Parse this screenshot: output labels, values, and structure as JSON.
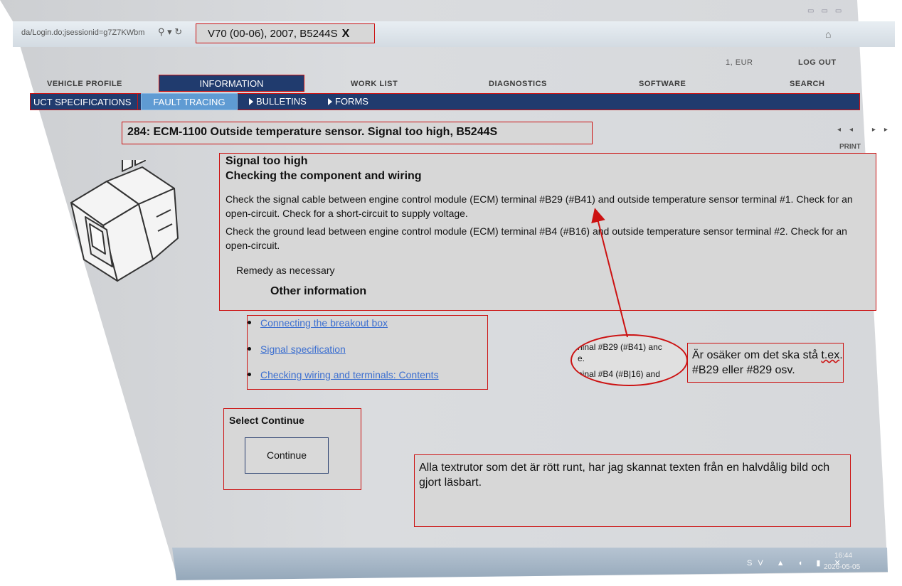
{
  "browser": {
    "url": "da/Login.do;jsessionid=g7Z7KWbm",
    "url_icons": "⚲ ▾ ↻",
    "right_icons": "⌂",
    "window_controls": "▭▭▭"
  },
  "tab": {
    "title": "V70 (00-06), 2007, B5244S",
    "close_label": "X"
  },
  "header": {
    "currency": "1, EUR",
    "logout": "LOG OUT"
  },
  "top_nav": {
    "vehicle_profile": "VEHICLE PROFILE",
    "information": "INFORMATION",
    "work_list": "WORK LIST",
    "diagnostics": "DIAGNOSTICS",
    "software": "SOFTWARE",
    "search": "SEARCH"
  },
  "sub_nav": {
    "product_specifications": "UCT SPECIFICATIONS",
    "fault_tracing": "FAULT TRACING",
    "bulletins": "BULLETINS",
    "forms": "FORMS"
  },
  "page": {
    "title": "284: ECM-1100 Outside temperature sensor. Signal too high, B5244S",
    "pager": "◂◂ ▸▸",
    "print": "PRINT"
  },
  "content": {
    "heading1": "Signal too high",
    "heading2": "Checking the component and wiring",
    "para1": "Check the signal cable between engine control module (ECM) terminal #B29 (#B41) and outside temperature sensor terminal #1. Check for an open-circuit. Check for a short-circuit to supply voltage.",
    "para2": "Check the ground lead between engine control module (ECM) terminal #B4 (#B16) and outside temperature sensor terminal #2. Check for an open-circuit.",
    "remedy": "Remedy as necessary",
    "other_info": "Other information"
  },
  "links": [
    "Connecting the breakout box",
    "Signal specification",
    "Checking wiring and terminals: Contents"
  ],
  "zoom_snippet": {
    "line1": "ninal #B29 (#B41) anc",
    "line2": "e.",
    "line3": "ninal #B4 (#B|16) and"
  },
  "notes": {
    "unsure_pre": "Är osäker om det ska stå ",
    "unsure_sq": "t.ex",
    "unsure_post": ". #B29 eller #829 osv.",
    "scanned": "Alla textrutor som det är rött runt, har jag skannat texten från en halvdålig bild och gjort läsbart."
  },
  "continue_section": {
    "label": "Select Continue",
    "button": "Continue"
  },
  "taskbar": {
    "tray": "SV ▲ ◖ ▮ ✕",
    "time": "16:44",
    "date": "2026-05-05"
  },
  "colors": {
    "nav_bg": "#203b6e",
    "fault_tab": "#5f9bd3",
    "annotation_red": "#cc1111",
    "link_blue": "#3c6fd0"
  }
}
